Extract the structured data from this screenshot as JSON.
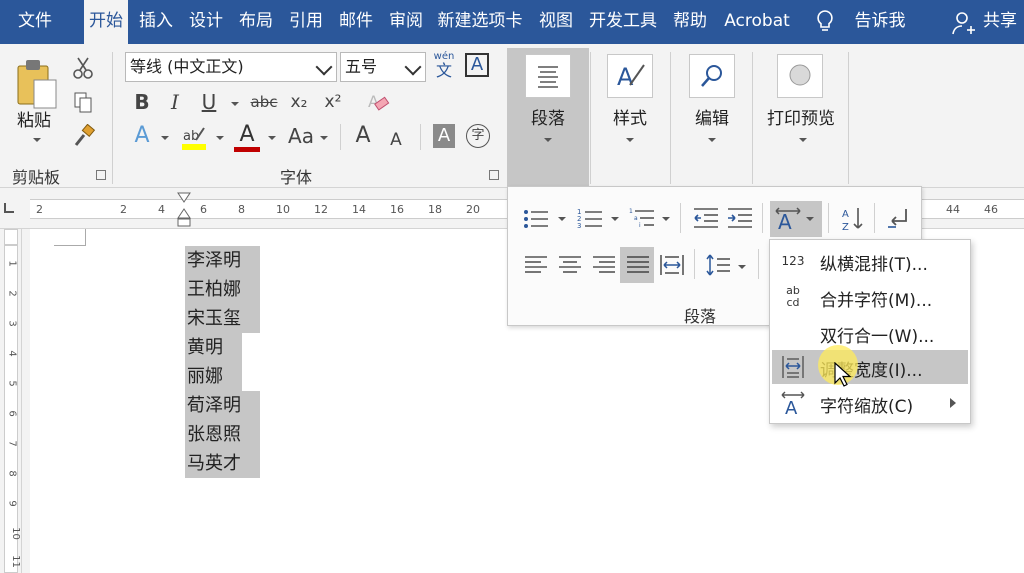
{
  "tabs": [
    {
      "label": "文件"
    },
    {
      "label": "开始"
    },
    {
      "label": "插入"
    },
    {
      "label": "设计"
    },
    {
      "label": "布局"
    },
    {
      "label": "引用"
    },
    {
      "label": "邮件"
    },
    {
      "label": "审阅"
    },
    {
      "label": "新建选项卡"
    },
    {
      "label": "视图"
    },
    {
      "label": "开发工具"
    },
    {
      "label": "帮助"
    },
    {
      "label": "Acrobat"
    }
  ],
  "tell_me": "告诉我",
  "share": "共享",
  "clipboard": {
    "paste_label": "粘贴",
    "group_label": "剪贴板"
  },
  "font": {
    "font_name": "等线 (中文正文)",
    "font_size": "五号",
    "phonetic_top": "wén",
    "phonetic_bottom": "文",
    "border_char": "A",
    "bold": "B",
    "italic": "I",
    "underline": "U",
    "strike": "abc",
    "subscript": "x₂",
    "superscript": "x²",
    "text_effect": "A",
    "font_color": "A",
    "change_case": "Aa",
    "grow": "A",
    "shrink": "A",
    "char_shade": "A",
    "enclose": "字",
    "group_label": "字体"
  },
  "big_buttons": {
    "paragraph": "段落",
    "styles": "样式",
    "editing": "编辑",
    "print_preview": "打印预览"
  },
  "paragraph_panel": {
    "group_label": "段落"
  },
  "ruler_numbers": [
    "2",
    "2",
    "4",
    "6",
    "8",
    "10",
    "12",
    "14",
    "16",
    "18",
    "20",
    "44",
    "46"
  ],
  "vruler_numbers": [
    "1",
    "2",
    "3",
    "4",
    "5",
    "6",
    "7",
    "8",
    "9",
    "10",
    "11"
  ],
  "names": [
    "李泽明",
    "王柏娜",
    "宋玉玺",
    "黄明",
    "丽娜",
    "荀泽明",
    "张恩照",
    "马英才"
  ],
  "submenu": {
    "items": [
      {
        "icon_text": "123",
        "label": "纵横混排(T)..."
      },
      {
        "icon_text": "ab cd",
        "label": "合并字符(M)..."
      },
      {
        "icon_text": "",
        "label": "双行合一(W)..."
      },
      {
        "icon_text": "",
        "label": "调整宽度(I)..."
      },
      {
        "icon_text": "",
        "label": "字符缩放(C)"
      }
    ]
  },
  "colors": {
    "accent": "#2b579a",
    "highlight": "#ffff00",
    "font_red": "#c00000"
  }
}
